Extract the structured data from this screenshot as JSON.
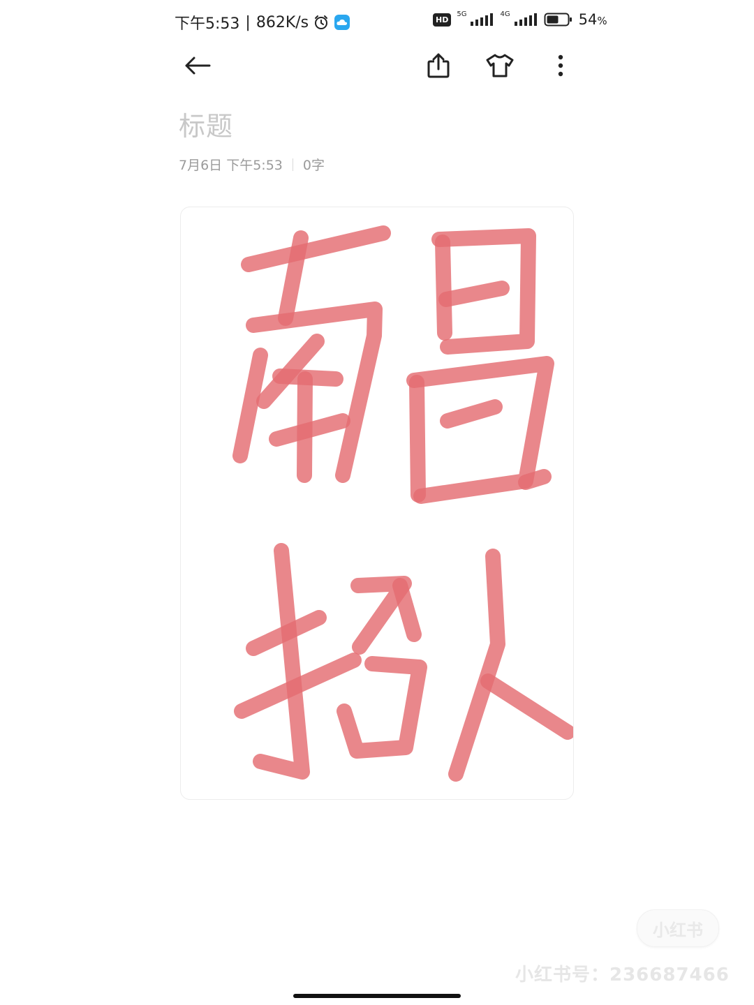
{
  "status_bar": {
    "time": "下午5:53",
    "separator": "|",
    "speed": "862K/s",
    "hd": "HD",
    "net1": "5G",
    "net2": "4G",
    "battery": "54",
    "battery_unit": "%"
  },
  "note": {
    "title_placeholder": "标题",
    "date": "7月6日 下午5:53",
    "word_count": "0字"
  },
  "drawing": {
    "ink_color": "#e46d72",
    "characters": [
      "南",
      "昌",
      "招",
      "人"
    ]
  },
  "watermark": {
    "badge": "小红书",
    "text": "小红书号：236687466"
  },
  "icons": [
    "back-arrow-icon",
    "share-icon",
    "theme-shirt-icon",
    "more-vertical-icon",
    "alarm-icon",
    "cloud-app-icon",
    "signal-icon",
    "battery-icon"
  ]
}
